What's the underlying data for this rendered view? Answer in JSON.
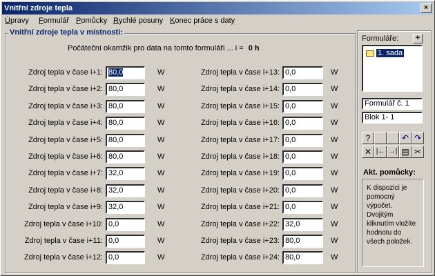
{
  "window": {
    "title": "Vnitřní zdroje tepla",
    "close_glyph": "×"
  },
  "menu": [
    {
      "mnemonic": "Ú",
      "rest": "pravy"
    },
    {
      "mnemonic": "F",
      "rest": "ormulář"
    },
    {
      "mnemonic": "P",
      "rest": "omůcky"
    },
    {
      "mnemonic": "R",
      "rest": "ychlé posuny"
    },
    {
      "mnemonic": "K",
      "rest": "onec práce s daty"
    }
  ],
  "main": {
    "group_title": "Vnitřní zdroje tepla v místnosti:",
    "start_label": "Počáteční okamžik pro data na tomto formuláři ... i =",
    "start_value": "0 h",
    "unit": "W",
    "fields": [
      {
        "label": "Zdroj tepla v čase i+1:",
        "value": "80,0"
      },
      {
        "label": "Zdroj tepla v čase i+2:",
        "value": "80,0"
      },
      {
        "label": "Zdroj tepla v čase i+3:",
        "value": "80,0"
      },
      {
        "label": "Zdroj tepla v čase i+4:",
        "value": "80,0"
      },
      {
        "label": "Zdroj tepla v čase i+5:",
        "value": "80,0"
      },
      {
        "label": "Zdroj tepla v čase i+6:",
        "value": "80,0"
      },
      {
        "label": "Zdroj tepla v čase i+7:",
        "value": "32,0"
      },
      {
        "label": "Zdroj tepla v čase i+8:",
        "value": "32,0"
      },
      {
        "label": "Zdroj tepla v čase i+9:",
        "value": "32,0"
      },
      {
        "label": "Zdroj tepla v čase i+10:",
        "value": "0,0"
      },
      {
        "label": "Zdroj tepla v čase i+11:",
        "value": "0,0"
      },
      {
        "label": "Zdroj tepla v čase i+12:",
        "value": "0,0"
      },
      {
        "label": "Zdroj tepla v čase i+13:",
        "value": "0,0"
      },
      {
        "label": "Zdroj tepla v čase i+14:",
        "value": "0,0"
      },
      {
        "label": "Zdroj tepla v čase i+15:",
        "value": "0,0"
      },
      {
        "label": "Zdroj tepla v čase i+16:",
        "value": "0,0"
      },
      {
        "label": "Zdroj tepla v čase i+17:",
        "value": "0,0"
      },
      {
        "label": "Zdroj tepla v čase i+18:",
        "value": "0,0"
      },
      {
        "label": "Zdroj tepla v čase i+19:",
        "value": "0,0"
      },
      {
        "label": "Zdroj tepla v čase i+20:",
        "value": "0,0"
      },
      {
        "label": "Zdroj tepla v čase i+21:",
        "value": "0,0"
      },
      {
        "label": "Zdroj tepla v čase i+22:",
        "value": "32,0"
      },
      {
        "label": "Zdroj tepla v čase i+23:",
        "value": "80,0"
      },
      {
        "label": "Zdroj tepla v čase i+24:",
        "value": "80,0"
      }
    ]
  },
  "side": {
    "forms_label": "Formuláře:",
    "add_glyph": "+",
    "tree_item": "1. sada",
    "form_no": "Formulář č. 1",
    "block": "Blok  1- 1",
    "tools_row1": [
      "?",
      "",
      "",
      "↶",
      "↷"
    ],
    "tools_row2": [
      "✕",
      "|←",
      "→|",
      "▤",
      "✂"
    ],
    "aids_title": "Akt. pomůcky:",
    "aids_text": "K dispozici je pomocný výpočet. Dvojitým kliknutím vložíte hodnotu do všech položek."
  },
  "colors": {
    "title_from": "#0a246a",
    "title_to": "#a6caf0",
    "selection": "#0a246a",
    "face": "#d4d0c8"
  }
}
